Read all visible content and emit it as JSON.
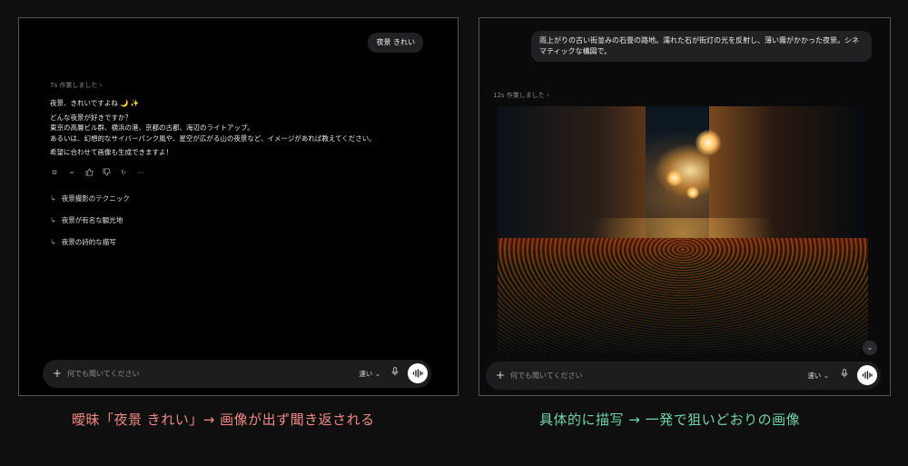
{
  "left": {
    "user_message": "夜景 きれい",
    "worked_label": "7s 作業しました",
    "reply": {
      "line1": "夜景、きれいですよね 🌙 ✨",
      "line2": "どんな夜景が好きですか？",
      "line3": "東京の高層ビル群、横浜の港、京都の古都、海辺のライトアップ。",
      "line4": "あるいは、幻想的なサイバーパンク風や、星空が広がる山の夜景など、イメージがあれば教えてください。",
      "line5": "希望に合わせて画像も生成できますよ！"
    },
    "suggestions": [
      "夜景撮影のテクニック",
      "夜景が有名な観光地",
      "夜景の詩的な描写"
    ],
    "composer": {
      "placeholder": "何でも聞いてください",
      "speed": "速い"
    }
  },
  "right": {
    "user_message": "雨上がりの古い街並みの石畳の路地。濡れた石が街灯の光を反射し、薄い霧がかかった夜景。シネマティックな構図で。",
    "worked_label": "12s 作業しました",
    "composer": {
      "placeholder": "何でも聞いてください",
      "speed": "速い"
    }
  },
  "captions": {
    "left": "曖昧「夜景 きれい」→ 画像が出ず聞き返される",
    "right": "具体的に描写 → 一発で狙いどおりの画像"
  },
  "colors": {
    "caption_left": "#f08a82",
    "caption_right": "#6fd4a8"
  }
}
